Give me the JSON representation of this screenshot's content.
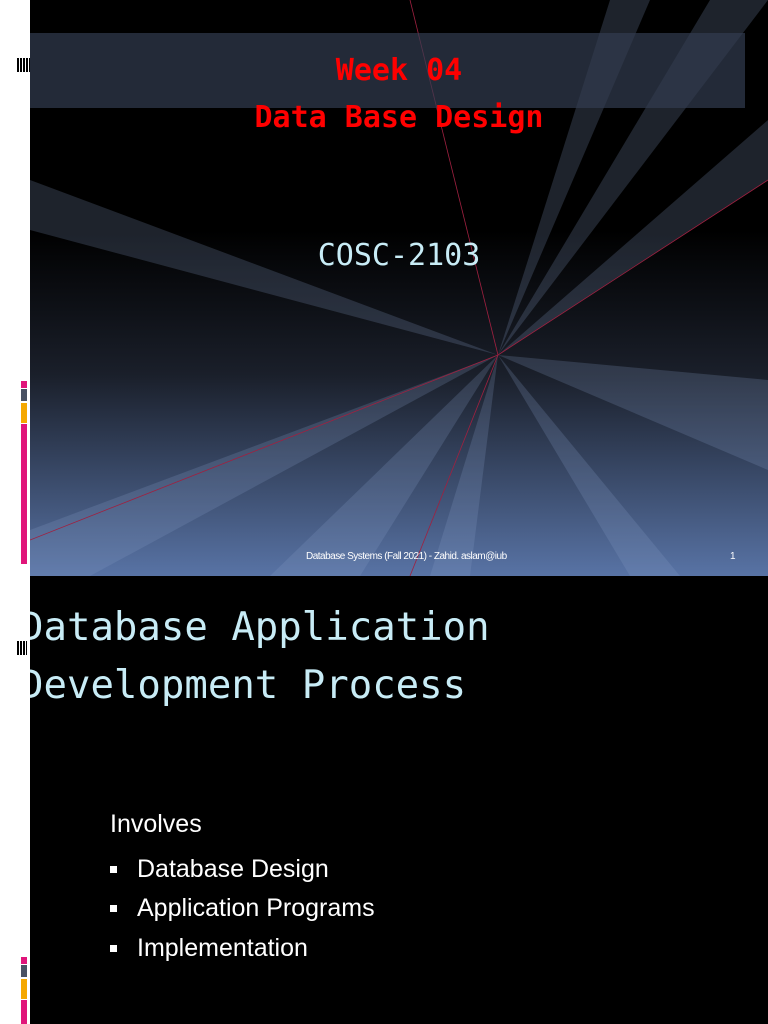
{
  "slide1": {
    "title_line1": "Week 04",
    "title_line2": "Data Base Design",
    "course_code": "COSC-2103",
    "footer": "Database Systems (Fall 2021) - Zahid. aslam@iub",
    "page_number": "1"
  },
  "slide2": {
    "title_line1": "Database Application",
    "title_line2": "Development Process",
    "intro": "Involves",
    "bullets": [
      "Database Design",
      "Application Programs",
      "Implementation"
    ]
  },
  "colors": {
    "title_red": "#ff0000",
    "cyan_text": "#c8ecf6",
    "accent_pink": "#e0157a",
    "accent_orange": "#f5a800"
  }
}
